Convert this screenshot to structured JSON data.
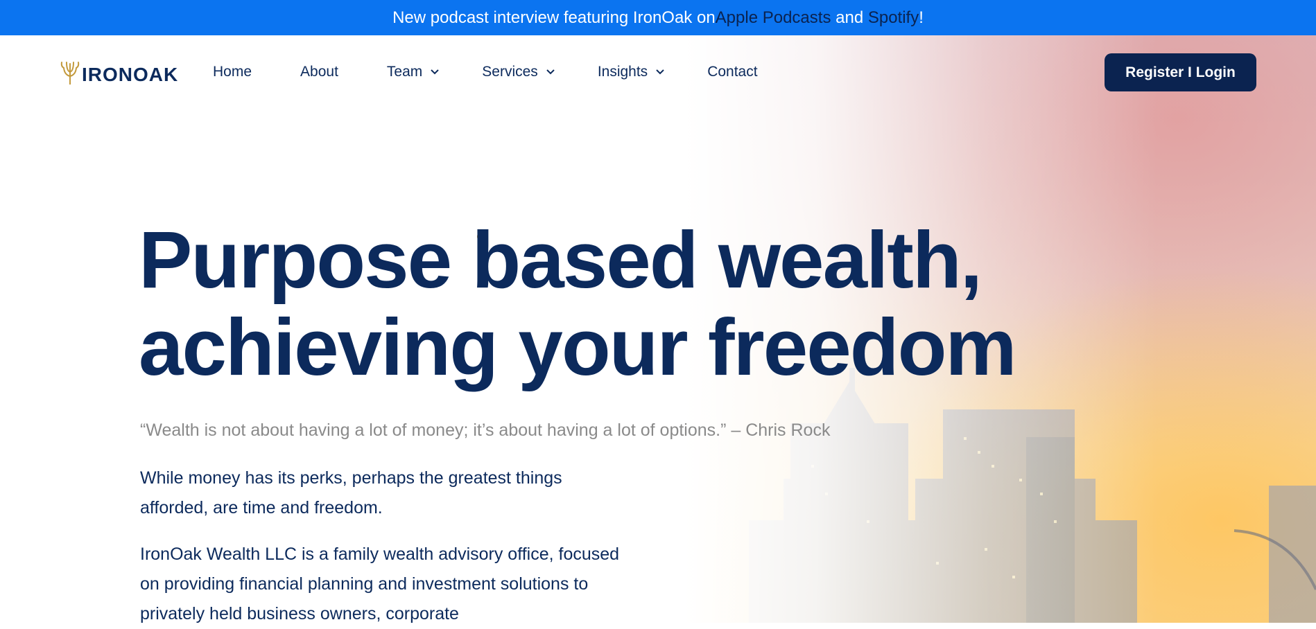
{
  "announcement": {
    "prefix": "New podcast interview featuring IronOak on ",
    "link1": "Apple Podcasts",
    "middle": " and ",
    "link2": "Spotify",
    "suffix": "!"
  },
  "header": {
    "logo_text": "IRONOAK",
    "nav": [
      {
        "label": "Home",
        "has_dropdown": false
      },
      {
        "label": "About",
        "has_dropdown": false
      },
      {
        "label": "Team",
        "has_dropdown": true
      },
      {
        "label": "Services",
        "has_dropdown": true
      },
      {
        "label": "Insights",
        "has_dropdown": true
      },
      {
        "label": "Contact",
        "has_dropdown": false
      }
    ],
    "login_label": "Register I Login"
  },
  "hero": {
    "headline_line1": "Purpose based wealth,",
    "headline_line2_prefix": "achieving your ",
    "headline_highlight": "freedom",
    "quote": "“Wealth is not about having a lot of money; it’s about having a lot of options.” – Chris Rock",
    "paragraph1": "While money has its perks, perhaps the greatest things afforded, are time and freedom.",
    "paragraph2": "IronOak Wealth LLC is a family wealth advisory office, focused on providing financial planning and investment solutions to privately held business owners, corporate"
  },
  "colors": {
    "announcement_bg": "#0b74f0",
    "navy": "#0c2a5c",
    "button_bg": "#0b2350",
    "gold": "#d2b777",
    "gold_dot": "#c39a3d",
    "quote_gray": "#8a8a8a"
  },
  "icons": {
    "logo": "oak-tree-icon",
    "dropdown": "chevron-down-icon"
  }
}
